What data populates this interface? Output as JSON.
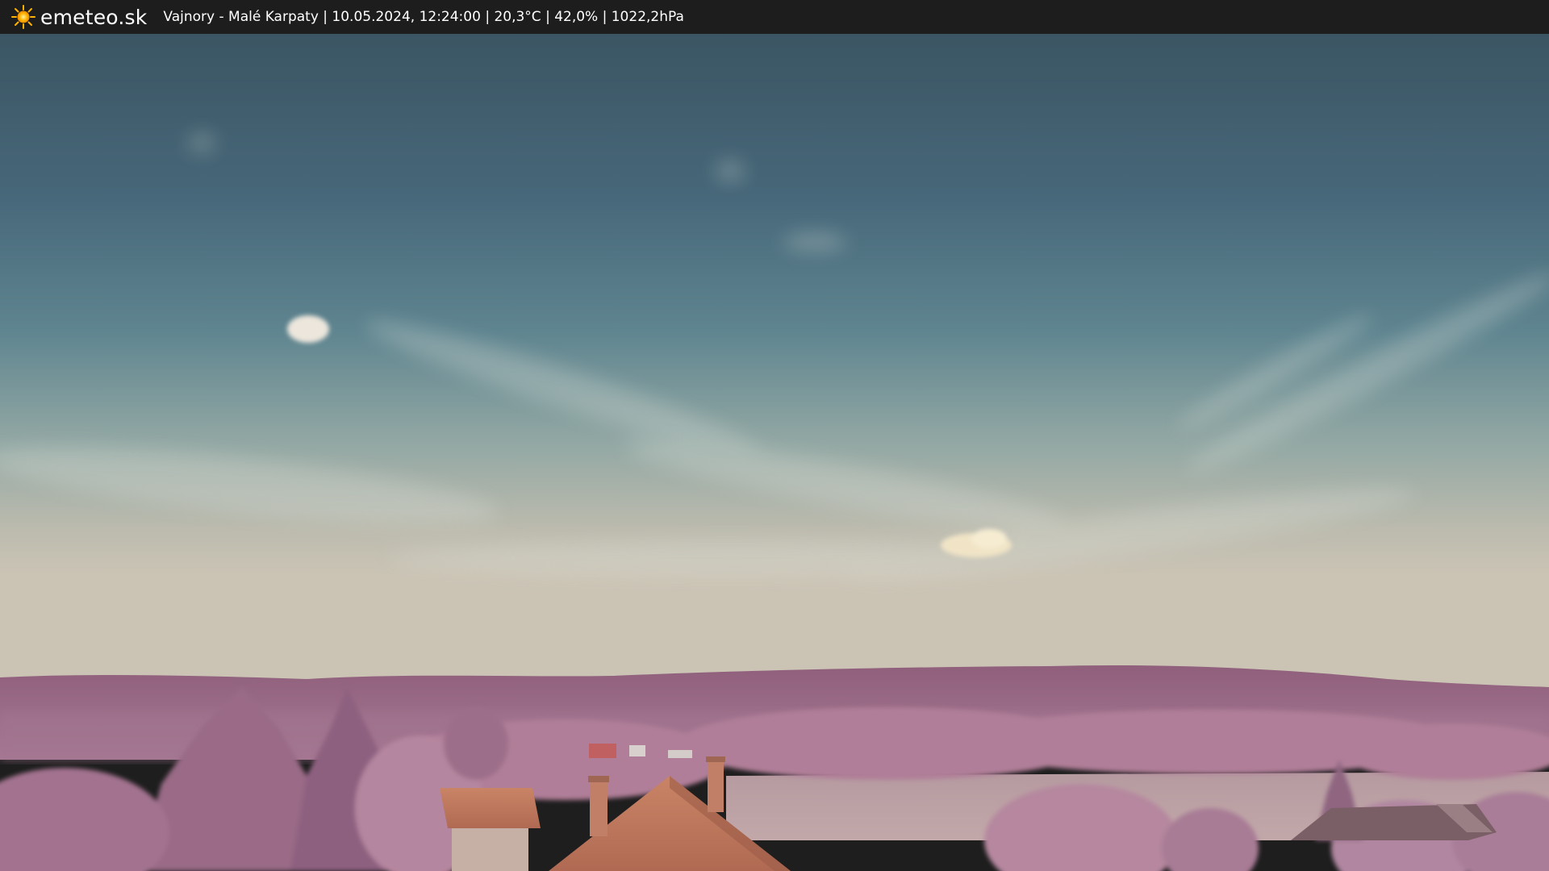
{
  "overlay": {
    "brand": "emeteo.sk",
    "logo_icon": "sun-icon",
    "caption": "Vajnory - Malé Karpaty | 10.05.2024, 12:24:00 | 20,3°C | 42,0% | 1022,2hPa"
  },
  "scene": {
    "subject": "webcam view of sky, hills and rooftops",
    "colors": {
      "sky_top": "#3d5866",
      "sky_mid": "#6f8f98",
      "sky_horizon": "#c9c4b4",
      "hills": "#9a6a86",
      "trees": "#b3809a",
      "roof": "#c86e58"
    }
  }
}
